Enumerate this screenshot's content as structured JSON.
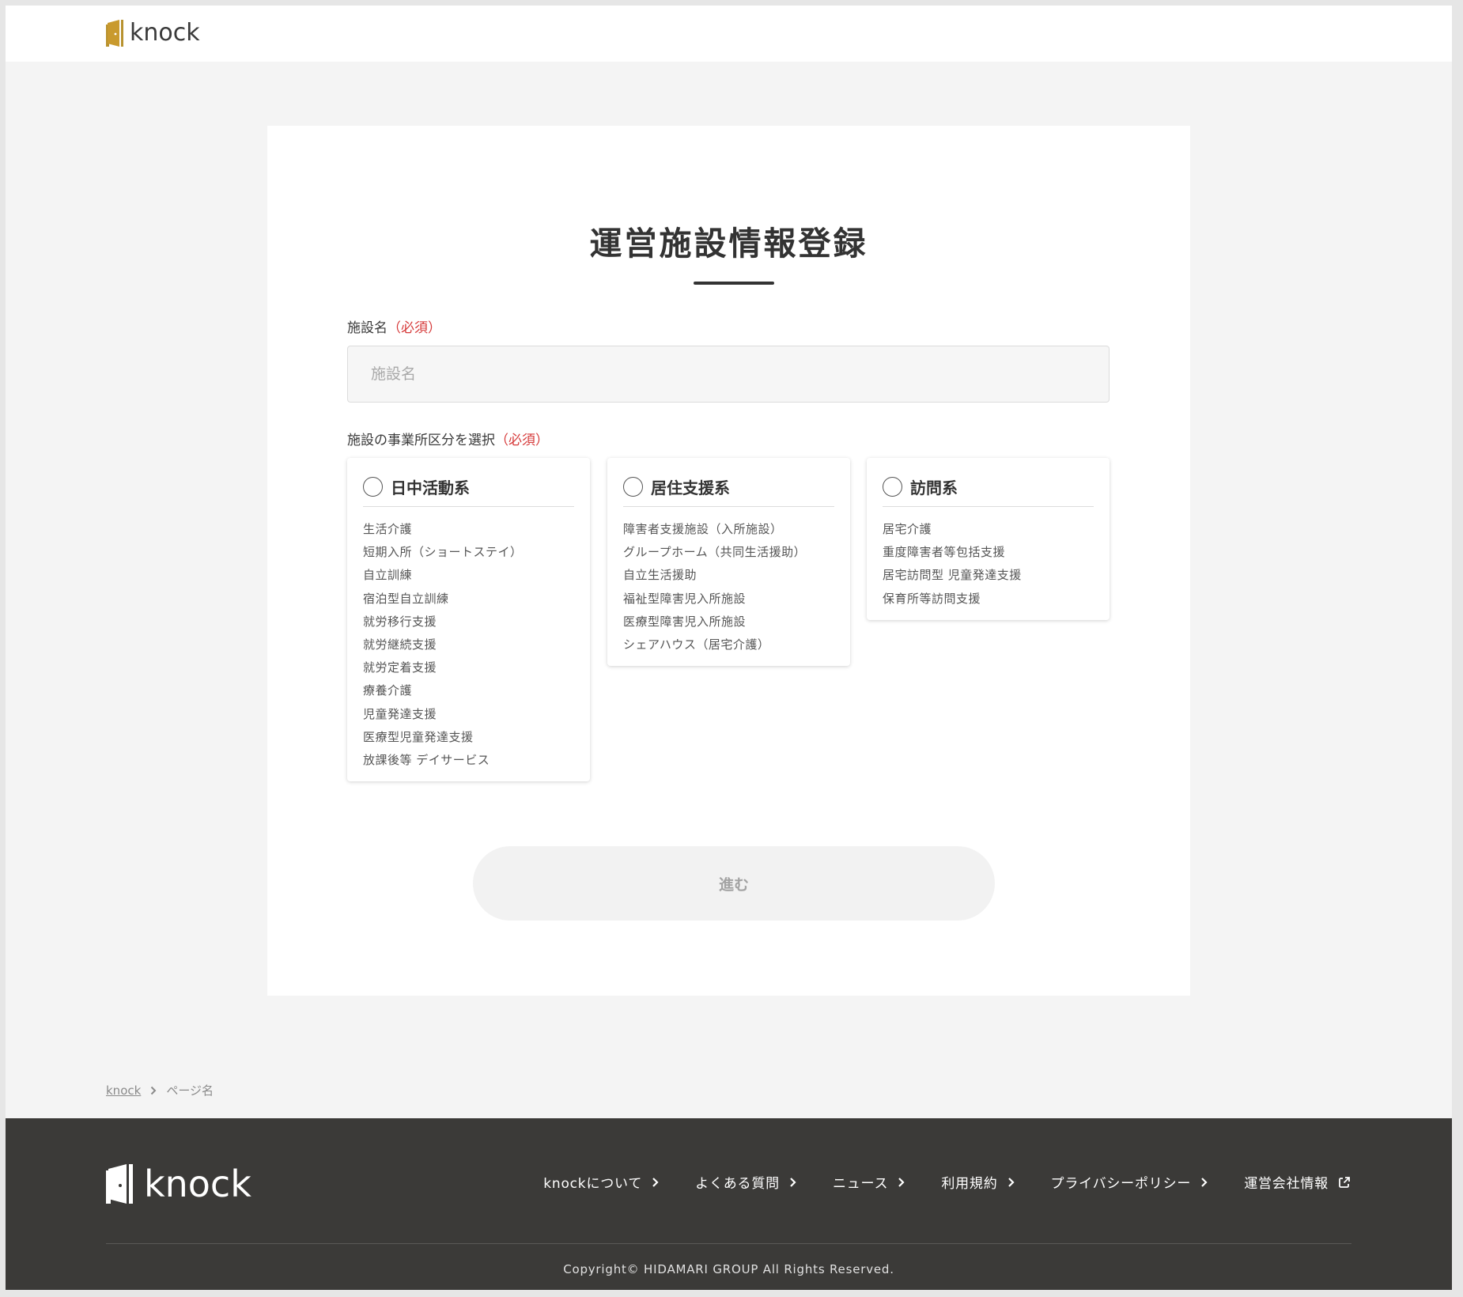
{
  "header": {
    "logo_text": "knock"
  },
  "form": {
    "title": "運営施設情報登録",
    "facility_name": {
      "label": "施設名",
      "required": "（必須）",
      "placeholder": "施設名",
      "value": ""
    },
    "category": {
      "label": "施設の事業所区分を選択",
      "required": "（必須）",
      "options": [
        {
          "title": "日中活動系",
          "selected": false,
          "items": [
            "生活介護",
            "短期入所（ショートステイ）",
            "自立訓練",
            "宿泊型自立訓練",
            "就労移行支援",
            "就労継続支援",
            "就労定着支援",
            "療養介護",
            "児童発達支援",
            "医療型児童発達支援",
            "放課後等 デイサービス"
          ]
        },
        {
          "title": "居住支援系",
          "selected": false,
          "items": [
            "障害者支援施設（入所施設）",
            "グループホーム（共同生活援助）",
            "自立生活援助",
            "福祉型障害児入所施設",
            "医療型障害児入所施設",
            "シェアハウス（居宅介護）"
          ]
        },
        {
          "title": "訪問系",
          "selected": false,
          "items": [
            "居宅介護",
            "重度障害者等包括支援",
            "居宅訪問型 児童発達支援",
            "保育所等訪問支援"
          ]
        }
      ]
    },
    "next_label": "進む"
  },
  "breadcrumb": {
    "home": "knock",
    "current": "ページ名"
  },
  "footer": {
    "logo_text": "knock",
    "links": [
      {
        "label": "knockについて",
        "icon": "chevron-right-icon"
      },
      {
        "label": "よくある質問",
        "icon": "chevron-right-icon"
      },
      {
        "label": "ニュース",
        "icon": "chevron-right-icon"
      },
      {
        "label": "利用規約",
        "icon": "chevron-right-icon"
      },
      {
        "label": "プライバシーポリシー",
        "icon": "chevron-right-icon"
      },
      {
        "label": "運営会社情報",
        "icon": "external-link-icon"
      }
    ],
    "copyright": "Copyright© HIDAMARI GROUP All Rights Reserved."
  },
  "colors": {
    "brand_gold": "#b8922f",
    "required_red": "#d63a3a",
    "footer_bg": "#3b3a38",
    "page_bg": "#f4f4f4"
  }
}
